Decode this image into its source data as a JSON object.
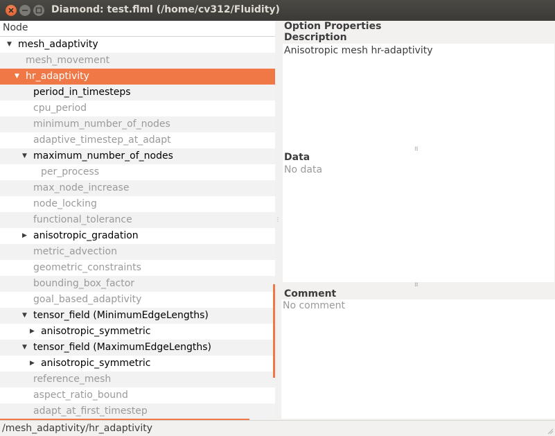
{
  "window": {
    "title": "Diamond: test.flml (/home/cv312/Fluidity)"
  },
  "tree": {
    "column_header": "Node",
    "rows": [
      {
        "label": "mesh_adaptivity",
        "state": "active",
        "indent": 0,
        "expander": "expanded"
      },
      {
        "label": "mesh_movement",
        "state": "inactive",
        "indent": 1,
        "expander": "none"
      },
      {
        "label": "hr_adaptivity",
        "state": "selected",
        "indent": 1,
        "expander": "expanded"
      },
      {
        "label": "period_in_timesteps",
        "state": "active",
        "indent": 2,
        "expander": "none"
      },
      {
        "label": "cpu_period",
        "state": "inactive",
        "indent": 2,
        "expander": "none"
      },
      {
        "label": "minimum_number_of_nodes",
        "state": "inactive",
        "indent": 2,
        "expander": "none"
      },
      {
        "label": "adaptive_timestep_at_adapt",
        "state": "inactive",
        "indent": 2,
        "expander": "none"
      },
      {
        "label": "maximum_number_of_nodes",
        "state": "active",
        "indent": 2,
        "expander": "expanded"
      },
      {
        "label": "per_process",
        "state": "inactive",
        "indent": 3,
        "expander": "none"
      },
      {
        "label": "max_node_increase",
        "state": "inactive",
        "indent": 2,
        "expander": "none"
      },
      {
        "label": "node_locking",
        "state": "inactive",
        "indent": 2,
        "expander": "none"
      },
      {
        "label": "functional_tolerance",
        "state": "inactive",
        "indent": 2,
        "expander": "none"
      },
      {
        "label": "anisotropic_gradation",
        "state": "active",
        "indent": 2,
        "expander": "collapsed"
      },
      {
        "label": "metric_advection",
        "state": "inactive",
        "indent": 2,
        "expander": "none"
      },
      {
        "label": "geometric_constraints",
        "state": "inactive",
        "indent": 2,
        "expander": "none"
      },
      {
        "label": "bounding_box_factor",
        "state": "inactive",
        "indent": 2,
        "expander": "none"
      },
      {
        "label": "goal_based_adaptivity",
        "state": "inactive",
        "indent": 2,
        "expander": "none"
      },
      {
        "label": "tensor_field (MinimumEdgeLengths)",
        "state": "active",
        "indent": 2,
        "expander": "expanded"
      },
      {
        "label": "anisotropic_symmetric",
        "state": "active",
        "indent": 3,
        "expander": "collapsed"
      },
      {
        "label": "tensor_field (MaximumEdgeLengths)",
        "state": "active",
        "indent": 2,
        "expander": "expanded"
      },
      {
        "label": "anisotropic_symmetric",
        "state": "active",
        "indent": 3,
        "expander": "collapsed"
      },
      {
        "label": "reference_mesh",
        "state": "inactive",
        "indent": 2,
        "expander": "none"
      },
      {
        "label": "aspect_ratio_bound",
        "state": "inactive",
        "indent": 2,
        "expander": "none"
      },
      {
        "label": "adapt_at_first_timestep",
        "state": "inactive",
        "indent": 2,
        "expander": "none"
      }
    ]
  },
  "properties": {
    "header": "Option Properties",
    "description_label": "Description",
    "description_text": "Anisotropic mesh hr-adaptivity",
    "data_label": "Data",
    "data_text": "No data",
    "comment_label": "Comment",
    "comment_text": "No comment"
  },
  "status": {
    "path": "/mesh_adaptivity/hr_adaptivity"
  },
  "colors": {
    "accent": "#f07746",
    "titlebar": "#3c3b37",
    "inactive_text": "#9a9a9a"
  }
}
